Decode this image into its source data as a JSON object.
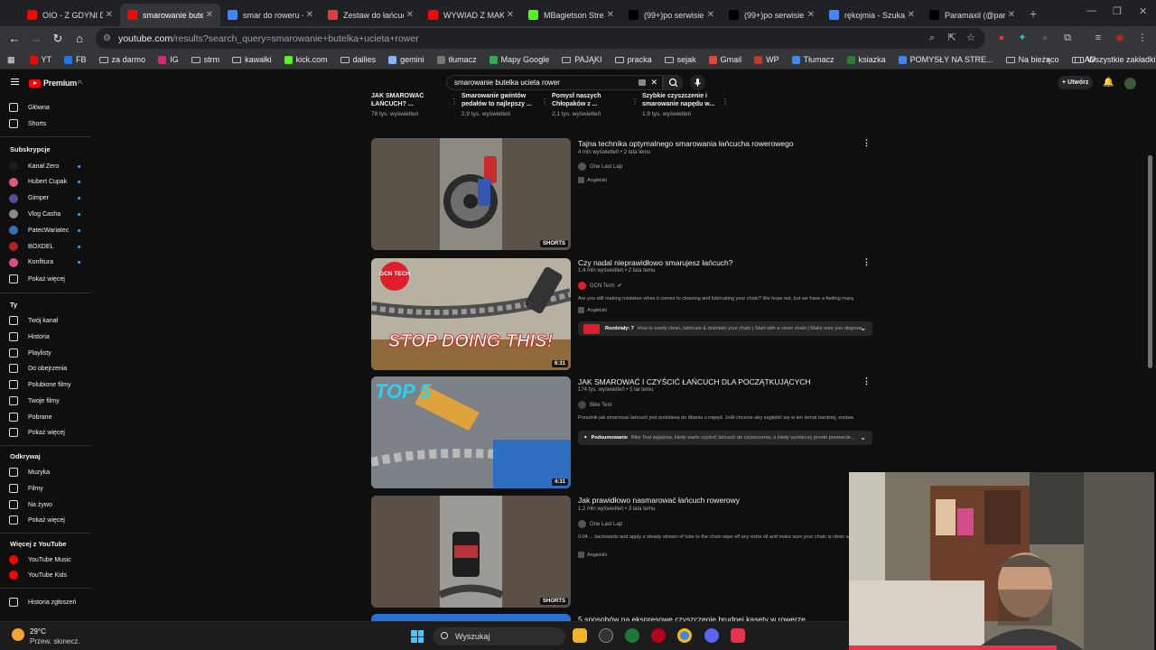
{
  "browser": {
    "tabs": [
      {
        "label": "OIO - Z GDYNI DO",
        "fav": "#ff0000"
      },
      {
        "label": "smarowanie butelk",
        "fav": "#ff0000"
      },
      {
        "label": "smar do roweru -",
        "fav": "#4285f4"
      },
      {
        "label": "Zestaw do łańcuch",
        "fav": "#e53935"
      },
      {
        "label": "WYWIAD Z MAKA",
        "fav": "#ff0000"
      },
      {
        "label": "MBagietson Strea",
        "fav": "#53fc18"
      },
      {
        "label": "(99+)po serwisie a",
        "fav": "#000000"
      },
      {
        "label": "(99+)po serwisie a",
        "fav": "#000000"
      },
      {
        "label": "rękojmia - Szukaj",
        "fav": "#4285f4"
      },
      {
        "label": "Paramaxil (@para",
        "fav": "#000000"
      }
    ],
    "new_tab": "+",
    "url_domain": "youtube.com",
    "url_rest": "/results?search_query=smarowanie+butelka+ucieta+rower",
    "bookmarks": [
      {
        "label": "YT",
        "color": "#ff0000"
      },
      {
        "label": "FB",
        "color": "#1877f2"
      },
      {
        "label": "za darmo",
        "color": "folder"
      },
      {
        "label": "IG",
        "color": "#d62976"
      },
      {
        "label": "strm",
        "color": "folder"
      },
      {
        "label": "kawałki",
        "color": "folder"
      },
      {
        "label": "kick.com",
        "color": "#53fc18"
      },
      {
        "label": "dailies",
        "color": "folder"
      },
      {
        "label": "gemini",
        "color": "#8ab4f8"
      },
      {
        "label": "tłumacz",
        "color": "#777777"
      },
      {
        "label": "Mapy Google",
        "color": "#34a853"
      },
      {
        "label": "PAJĄKI",
        "color": "folder"
      },
      {
        "label": "pracka",
        "color": "folder"
      },
      {
        "label": "sejak",
        "color": "folder"
      },
      {
        "label": "Gmail",
        "color": "#ea4335"
      },
      {
        "label": "WP",
        "color": "#c0392b"
      },
      {
        "label": "Tłumacz",
        "color": "#4285f4"
      },
      {
        "label": "ksiazka",
        "color": "#2e7d32"
      },
      {
        "label": "POMYSŁY NA STRE...",
        "color": "#4285f4"
      },
      {
        "label": "Na bieżąco",
        "color": "folder"
      },
      {
        "label": "AD",
        "color": "folder"
      }
    ],
    "all_bookmarks": "Wszystkie zakładki"
  },
  "yt": {
    "logo": "Premium",
    "logo_sup": "PL",
    "search_value": "smarowanie butelka ucieta rower",
    "create_label": "+ Utwórz",
    "sidebar": {
      "top": [
        {
          "label": "Główna"
        },
        {
          "label": "Shorts"
        }
      ],
      "subs_head": "Subskrypcje",
      "subs": [
        {
          "label": "Kanał Zero",
          "color": "#1b1b1b"
        },
        {
          "label": "Hubert Cupak",
          "color": "#e05a7a"
        },
        {
          "label": "Gimper",
          "color": "#5b4d9a"
        },
        {
          "label": "Vlog Casha",
          "color": "#8a8a8a"
        },
        {
          "label": "PatecWariatec",
          "color": "#3b6db5"
        },
        {
          "label": "BOXDEL",
          "color": "#b52020"
        },
        {
          "label": "Konfitura",
          "color": "#d94f8a"
        }
      ],
      "subs_more": "Pokaż więcej",
      "you_head": "Ty",
      "you": [
        {
          "label": "Twój kanał"
        },
        {
          "label": "Historia"
        },
        {
          "label": "Playlisty"
        },
        {
          "label": "Do obejrzenia"
        },
        {
          "label": "Polubione filmy"
        },
        {
          "label": "Twoje filmy"
        },
        {
          "label": "Pobrane"
        },
        {
          "label": "Pokaż więcej"
        }
      ],
      "explore_head": "Odkrywaj",
      "explore": [
        {
          "label": "Muzyka"
        },
        {
          "label": "Filmy"
        },
        {
          "label": "Na żywo"
        },
        {
          "label": "Pokaż więcej"
        }
      ],
      "more_head": "Więcej z YouTube",
      "more": [
        {
          "label": "YouTube Music"
        },
        {
          "label": "YouTube Kids"
        }
      ],
      "report": "Historia zgłoszeń"
    },
    "related": [
      {
        "title": "JAK SMAROWAĆ ŁAŃCUCH? ...",
        "views": "78 tys. wyświetleń"
      },
      {
        "title": "Smarowanie gwintów pedałów to najlepszy ...",
        "views": "2,9 tys. wyświetleń"
      },
      {
        "title": "Pomysł naszych Chłopaków z ...",
        "views": "2,1 tys. wyświetleń"
      },
      {
        "title": "Szybkie czyszczenie i smarowanie napędu w...",
        "views": "1,9 tys. wyświetleń"
      }
    ],
    "results": [
      {
        "title": "Tajna technika optymalnego smarowania łańcucha rowerowego",
        "meta": "4 mln wyświetleń • 2 lata temu",
        "channel": "One Last Lap",
        "desc": "",
        "tag": "Angielski",
        "badge": "SHORTS",
        "chap_head": "",
        "chap_text": ""
      },
      {
        "title": "Czy nadal nieprawidłowo smarujesz łańcuch?",
        "meta": "1,4 mln wyświetleń • 2 lata temu",
        "channel": "GCN Tech",
        "desc": "Are you still making mistakes when it comes to cleaning and lubricating your chain? We hope not, but we have a feeling many ...",
        "tag": "Angielski",
        "badge": "6:31",
        "chap_head": "Rozdziały: 7",
        "chap_text": "How to easily clean, lubricate & maintain your chain | Start with a clean chain | Make sure you degreas..."
      },
      {
        "title": "JAK SMAROWAĆ I CZYŚCIĆ ŁAŃCUCH DLA POCZĄTKUJĄCYCH",
        "meta": "174 tys. wyświetleń • 5 lat temu",
        "channel": "Bike Test",
        "desc": "Poradnik jak smarować łańcuch jest podstawą do dbania o napęd. Jeśli chcecie aby zagłębić się w ten temat bardziej, zostawcie ...",
        "tag": "",
        "badge": "4:31",
        "chap_head": "Podsumowanie",
        "chap_text": "Bike Test wyjaśnia, kiedy warto czyścić łańcuch do czyszczenia, a kiedy wystarczy proste przetarcie..."
      },
      {
        "title": "Jak prawidłowo nasmarować łańcuch rowerowy",
        "meta": "1,2 mln wyświetleń • 3 lata temu",
        "channel": "One Last Lap",
        "desc": "0:04 ... backwards and apply a steady stream of lube to the chain wipe off any extra oil and make sure your chain is clean and the ...",
        "tag": "Angielski",
        "badge": "SHORTS",
        "chap_head": "",
        "chap_text": ""
      },
      {
        "title": "5 sposobów na ekspresowe czyszczenie brudnej kasety w rowerze",
        "meta": "",
        "channel": "",
        "desc": "",
        "tag": "",
        "badge": "",
        "chap_head": "",
        "chap_text": ""
      }
    ],
    "thumb_text": {
      "gcn_badge": "GCN TECH",
      "stop": "STOP DOING THIS!",
      "top5": "TOP 5"
    }
  },
  "taskbar": {
    "temp": "29°C",
    "weather": "Przew. słonecz.",
    "search": "Wyszukaj"
  }
}
